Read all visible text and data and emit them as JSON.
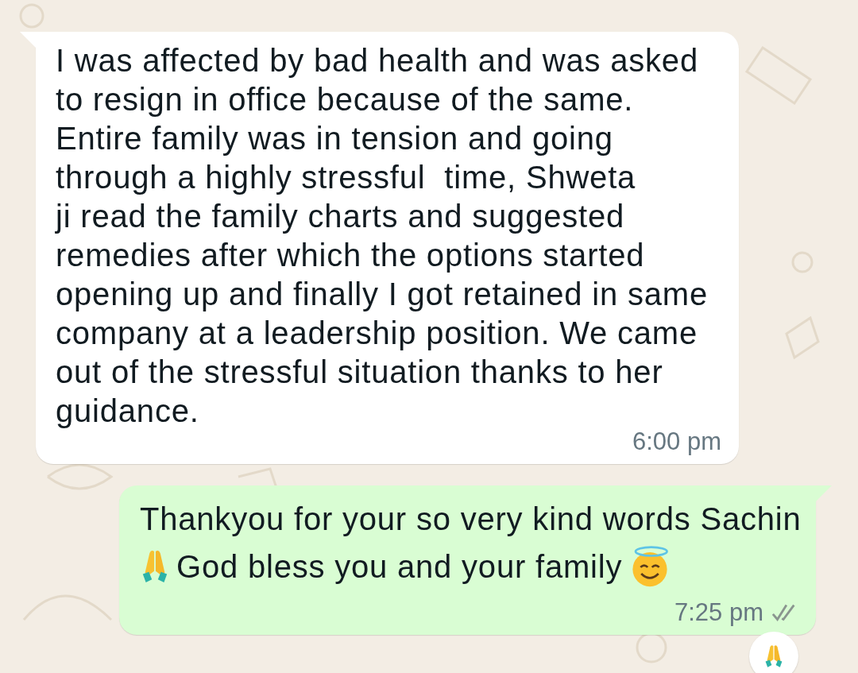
{
  "messages": [
    {
      "kind": "incoming",
      "lines": [
        "I was affected by bad health and was asked",
        "to resign in office because of the same.",
        "Entire family was in tension and going",
        "through a highly stressful  time, Shweta",
        "ji read the family charts and suggested",
        "remedies after which the options started",
        "opening up and finally I got retained in same",
        "company at a leadership position. We came",
        "out of the stressful situation thanks to her",
        "guidance."
      ],
      "time": "6:00 pm"
    },
    {
      "kind": "outgoing",
      "lines": [
        "Thankyou for your so very kind words Sachin",
        "God bless you and your family"
      ],
      "time": "7:25 pm",
      "reaction": true
    }
  ]
}
